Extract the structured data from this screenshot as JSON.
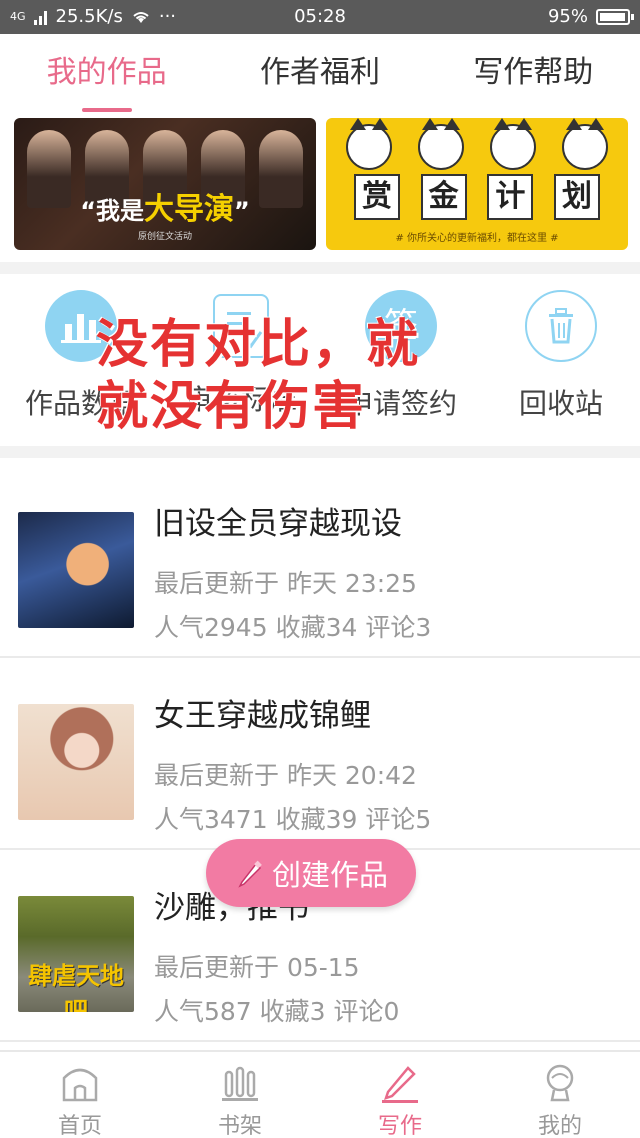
{
  "status_bar": {
    "network": "4G",
    "speed": "25.5K/s",
    "more": "···",
    "time": "05:28",
    "battery": "95%"
  },
  "top_tabs": [
    {
      "label": "我的作品",
      "active": true
    },
    {
      "label": "作者福利",
      "active": false
    },
    {
      "label": "写作帮助",
      "active": false
    }
  ],
  "banners": {
    "left": {
      "title_prefix": "“我是",
      "title_big": "大导演",
      "title_suffix": "”",
      "subtitle": "原创征文活动"
    },
    "right": {
      "chars": [
        "赏",
        "金",
        "计",
        "划"
      ],
      "caption": "# 你所关心的更新福利，都在这里 #"
    }
  },
  "tools": [
    {
      "label": "作品数据",
      "icon": "bar-chart-icon"
    },
    {
      "label": "审核标准",
      "icon": "document-check-icon"
    },
    {
      "label": "申请签约",
      "icon": "sign-icon",
      "icon_text": "签"
    },
    {
      "label": "回收站",
      "icon": "trash-icon"
    }
  ],
  "overlay": {
    "line1": "没有对比，就",
    "line2": "就没有伤害"
  },
  "works": [
    {
      "title": "旧设全员穿越现设",
      "updated": "最后更新于 昨天 23:25",
      "stats": "人气2945 收藏34 评论3"
    },
    {
      "title": "女王穿越成锦鲤",
      "updated": "最后更新于 昨天 20:42",
      "stats": "人气3471 收藏39 评论5"
    },
    {
      "title": "沙雕，推书",
      "updated": "最后更新于 05-15",
      "stats": "人气587 收藏3 评论0",
      "cover_text": "肆虐天地吧"
    }
  ],
  "fab": {
    "label": "创建作品"
  },
  "bottom_nav": [
    {
      "label": "首页",
      "icon": "home-icon",
      "active": false
    },
    {
      "label": "书架",
      "icon": "bookshelf-icon",
      "active": false
    },
    {
      "label": "写作",
      "icon": "pen-icon",
      "active": true
    },
    {
      "label": "我的",
      "icon": "profile-icon",
      "active": false
    }
  ],
  "colors": {
    "accent": "#e86a8a",
    "fab": "#f27ba3",
    "tool_icon": "#8fd4f2",
    "overlay": "#e53232"
  }
}
